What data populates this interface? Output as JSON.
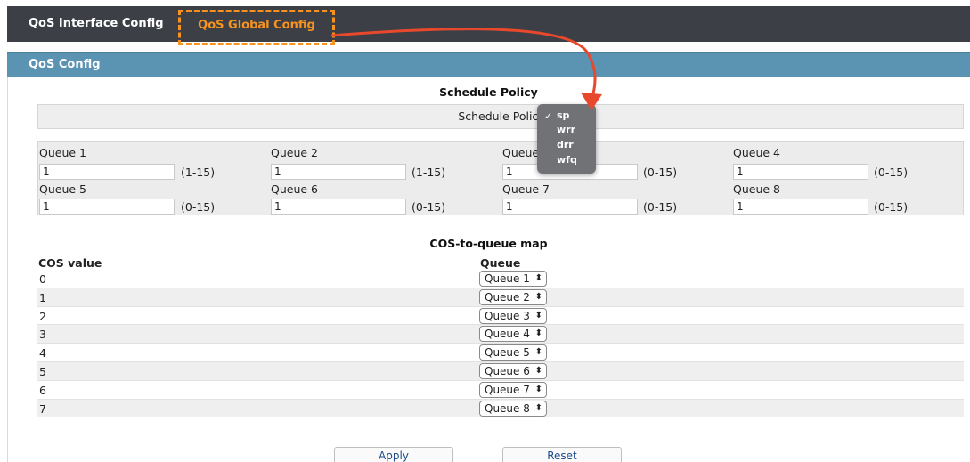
{
  "tabs": [
    {
      "label": "QoS Interface Config"
    },
    {
      "label": "QoS Global Config"
    }
  ],
  "panel": {
    "title": "QoS Config"
  },
  "schedule": {
    "title": "Schedule Policy",
    "label": "Schedule Policy",
    "dropdown": {
      "selected": "sp",
      "options": [
        "sp",
        "wrr",
        "drr",
        "wfq"
      ]
    }
  },
  "queues": [
    {
      "label": "Queue 1",
      "value": "1",
      "range": "(1-15)"
    },
    {
      "label": "Queue 2",
      "value": "1",
      "range": "(1-15)"
    },
    {
      "label": "Queue",
      "value": "1",
      "range": "(0-15)"
    },
    {
      "label": "Queue 4",
      "value": "1",
      "range": "(0-15)"
    },
    {
      "label": "Queue 5",
      "value": "1",
      "range": "(0-15)"
    },
    {
      "label": "Queue 6",
      "value": "1",
      "range": "(0-15)"
    },
    {
      "label": "Queue 7",
      "value": "1",
      "range": "(0-15)"
    },
    {
      "label": "Queue 8",
      "value": "1",
      "range": "(0-15)"
    }
  ],
  "cos": {
    "title": "COS-to-queue map",
    "col_value": "COS value",
    "col_queue": "Queue",
    "rows": [
      {
        "cos": "0",
        "queue": "Queue 1"
      },
      {
        "cos": "1",
        "queue": "Queue 2"
      },
      {
        "cos": "2",
        "queue": "Queue 3"
      },
      {
        "cos": "3",
        "queue": "Queue 4"
      },
      {
        "cos": "4",
        "queue": "Queue 5"
      },
      {
        "cos": "5",
        "queue": "Queue 6"
      },
      {
        "cos": "6",
        "queue": "Queue 7"
      },
      {
        "cos": "7",
        "queue": "Queue 8"
      }
    ]
  },
  "buttons": {
    "apply": "Apply",
    "reset": "Reset"
  },
  "colors": {
    "accent": "#f7931e",
    "arrow": "#e8482c",
    "header": "#5b93b3",
    "topbar": "#3c3f45"
  }
}
